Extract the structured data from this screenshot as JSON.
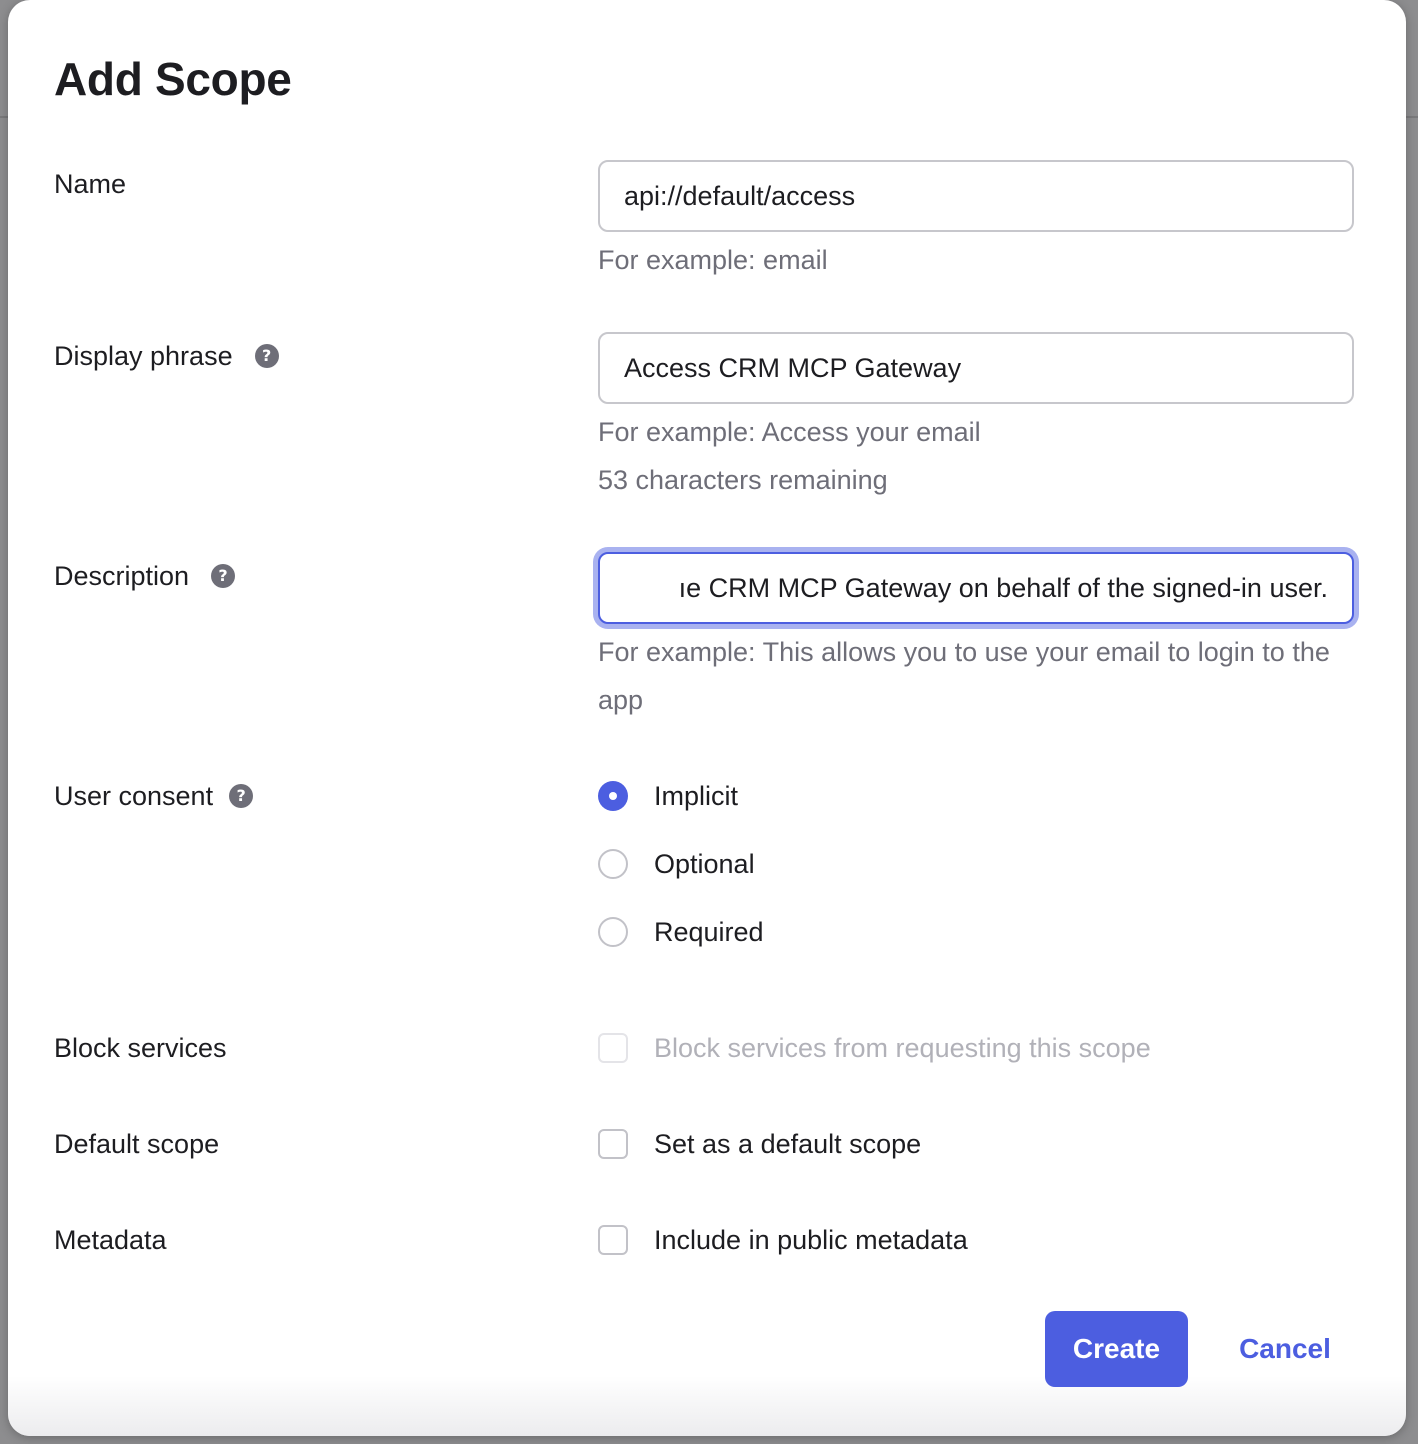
{
  "dialog": {
    "title": "Add Scope",
    "fields": {
      "name": {
        "label": "Name",
        "value": "api://default/access",
        "hint": "For example: email"
      },
      "display_phrase": {
        "label": "Display phrase",
        "value": "Access CRM MCP Gateway",
        "hint": "For example: Access your email",
        "remaining": "53 characters remaining"
      },
      "description": {
        "label": "Description",
        "value": "ıe CRM MCP Gateway on behalf of the signed-in user.",
        "hint": "For example: This allows you to use your email to login to the app"
      },
      "user_consent": {
        "label": "User consent",
        "options": [
          "Implicit",
          "Optional",
          "Required"
        ],
        "selected": "Implicit"
      },
      "block_services": {
        "label": "Block services",
        "option": "Block services from requesting this scope",
        "checked": false,
        "disabled": true
      },
      "default_scope": {
        "label": "Default scope",
        "option": "Set as a default scope",
        "checked": false
      },
      "metadata": {
        "label": "Metadata",
        "option": "Include in public metadata",
        "checked": false
      }
    },
    "help_icon": "question-mark",
    "buttons": {
      "create": "Create",
      "cancel": "Cancel"
    },
    "accent_color": "#4c5ee0"
  }
}
